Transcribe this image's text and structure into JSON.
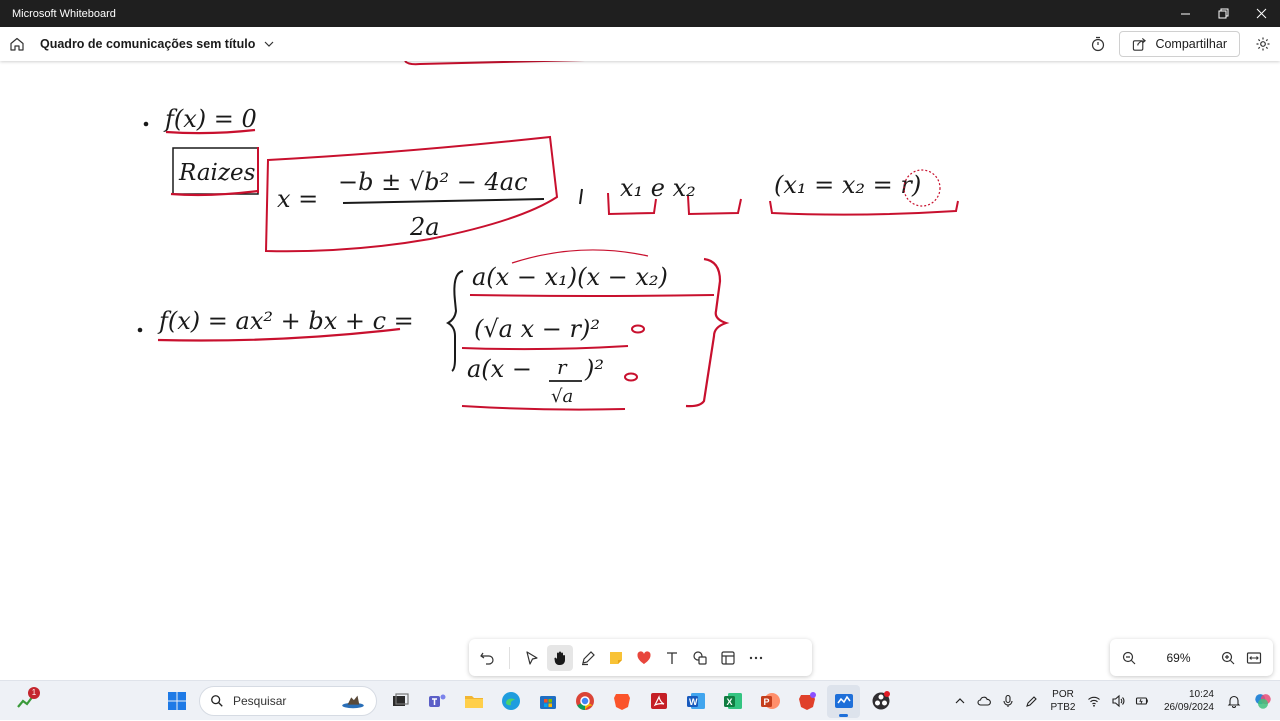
{
  "window": {
    "title": "Microsoft Whiteboard"
  },
  "header": {
    "board_title": "Quadro de comunicações sem título",
    "share_label": "Compartilhar"
  },
  "canvas": {
    "ink": {
      "line1": "f(x) = 0",
      "raizes": "Raizes",
      "quadratic_formula_lhs": "x =",
      "quadratic_formula_num": "−b ± √b² − 4ac",
      "quadratic_formula_den": "2a",
      "roots": "x₁ e x₂",
      "double_root": "(x₁ = x₂ = r)",
      "line2_lhs": "f(x) = ax² + bx + c =",
      "form_factored": "a(x − x₁)(x − x₂)",
      "form_square": "(√a x − r)²",
      "form_vertex_head": "a(x −",
      "form_vertex_frac_num": "r",
      "form_vertex_frac_den": "√a",
      "form_vertex_tail": ")²"
    }
  },
  "toolbar": {
    "tools": [
      "undo-icon",
      "select-icon",
      "hand-icon",
      "pen-icon",
      "sticky-note-icon",
      "reactions-icon",
      "text-icon",
      "shapes-icon",
      "templates-icon",
      "more-icon"
    ],
    "active_tool": "hand-icon"
  },
  "zoom": {
    "level": "69%"
  },
  "taskbar": {
    "search_placeholder": "Pesquisar",
    "notification_count": "1",
    "language": "POR",
    "keyboard": "PTB2",
    "time": "10:24",
    "date": "26/09/2024"
  },
  "colors": {
    "ink_black": "#1a1a1a",
    "ink_red": "#c8102e",
    "titlebar_bg": "#1f1f1f",
    "taskbar_bg": "#eef1f6"
  }
}
